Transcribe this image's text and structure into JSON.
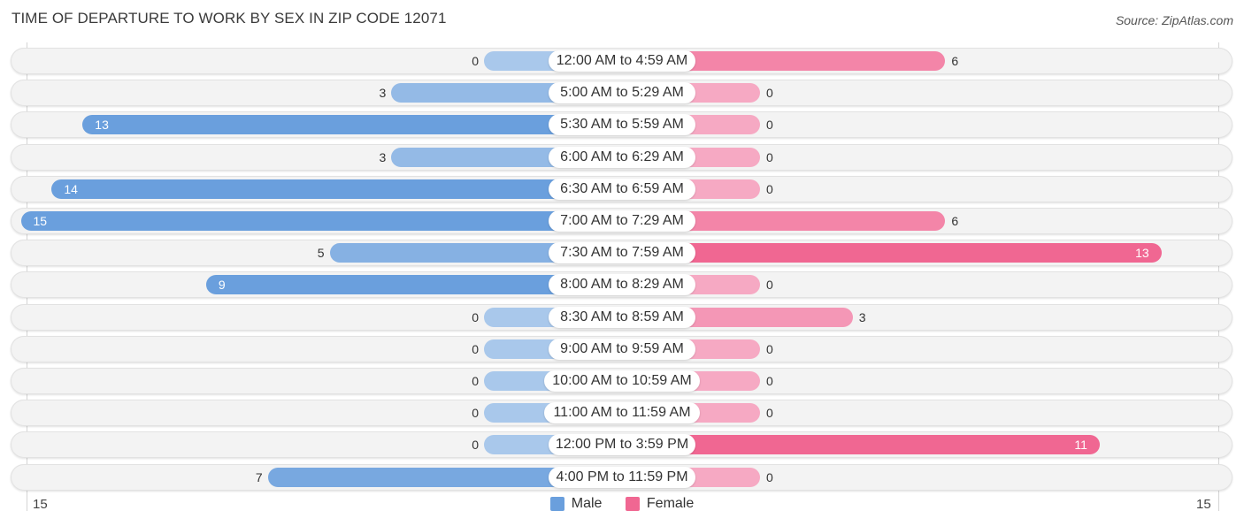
{
  "header": {
    "title": "TIME OF DEPARTURE TO WORK BY SEX IN ZIP CODE 12071",
    "source": "Source: ZipAtlas.com"
  },
  "colors": {
    "male_strong": "#6a9fdd",
    "male_light": "#a9c8eb",
    "female_strong": "#f06792",
    "female_light": "#f6a9c3"
  },
  "chart_data": {
    "type": "bar",
    "orientation": "horizontal-diverging",
    "title": "TIME OF DEPARTURE TO WORK BY SEX IN ZIP CODE 12071",
    "categories": [
      "12:00 AM to 4:59 AM",
      "5:00 AM to 5:29 AM",
      "5:30 AM to 5:59 AM",
      "6:00 AM to 6:29 AM",
      "6:30 AM to 6:59 AM",
      "7:00 AM to 7:29 AM",
      "7:30 AM to 7:59 AM",
      "8:00 AM to 8:29 AM",
      "8:30 AM to 8:59 AM",
      "9:00 AM to 9:59 AM",
      "10:00 AM to 10:59 AM",
      "11:00 AM to 11:59 AM",
      "12:00 PM to 3:59 PM",
      "4:00 PM to 11:59 PM"
    ],
    "series": [
      {
        "name": "Male",
        "values": [
          0,
          3,
          13,
          3,
          14,
          15,
          5,
          9,
          0,
          0,
          0,
          0,
          0,
          7
        ]
      },
      {
        "name": "Female",
        "values": [
          6,
          0,
          0,
          0,
          0,
          6,
          13,
          0,
          3,
          0,
          0,
          0,
          11,
          0
        ]
      }
    ],
    "axis": {
      "left_max_label": "15",
      "right_max_label": "15",
      "range": [
        0,
        15
      ]
    },
    "legend": {
      "entries": [
        "Male",
        "Female"
      ],
      "placement": "bottom-center"
    },
    "grid": false
  }
}
